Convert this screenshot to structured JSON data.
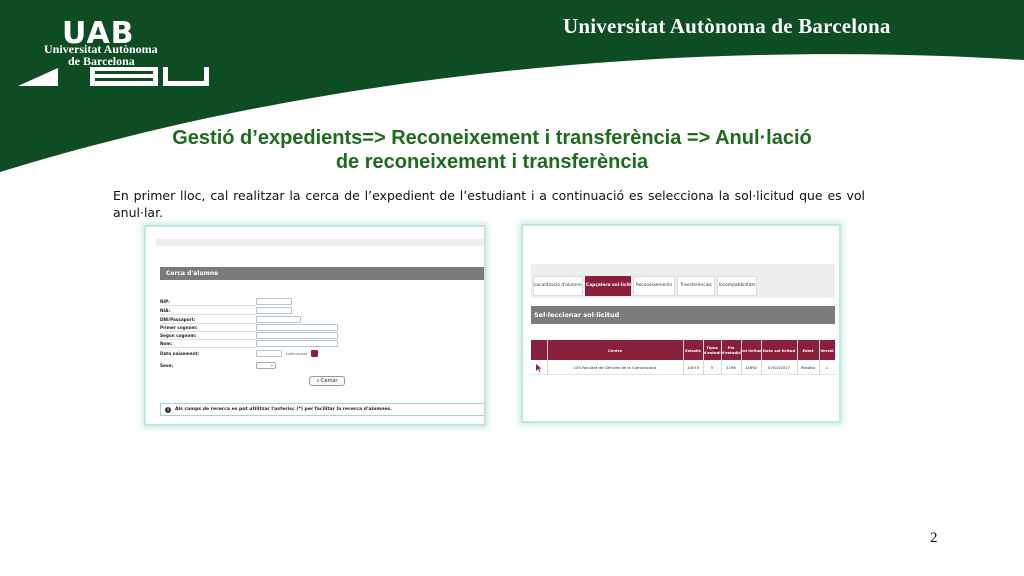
{
  "header": {
    "logo_text": "UAB",
    "logo_line1": "Universitat Autònoma",
    "logo_line2": "de Barcelona",
    "university_name": "Universitat Autònoma de Barcelona",
    "brand_green": "#0e4d24"
  },
  "slide": {
    "title_line1": "Gestió d’expedients=> Reconeixement i transferència => Anul·lació",
    "title_line2": "de reconeixement i transferència",
    "intro_text": "En primer lloc, cal realitzar la cerca de l’expedient de l’estudiant i a continuació es selecciona la sol·licitud que es vol anul·lar.",
    "page_number": "2"
  },
  "search_form": {
    "header": "Cerca d'alumne",
    "fields": [
      {
        "label": "NIP:"
      },
      {
        "label": "NIA:"
      },
      {
        "label": "DNI/Passaport:"
      },
      {
        "label": "Primer cognom:"
      },
      {
        "label": "Segon cognom:"
      },
      {
        "label": "Nom:"
      },
      {
        "label": "Data naixement:"
      },
      {
        "label": "Sexe:"
      }
    ],
    "date_hint": "(dd/mm/aa)",
    "search_button": "Cercar",
    "info_note": "Als camps de recerca es pot utilitzar l'asterisc (*) per facilitar la recerca d'alumnes."
  },
  "request_panel": {
    "tabs": [
      {
        "label": "Localització d'alumne"
      },
      {
        "label": "Capçalera sol·licitud"
      },
      {
        "label": "Reconeixements"
      },
      {
        "label": "Transferències"
      },
      {
        "label": "Incompatibilitats"
      }
    ],
    "section_title": "Sel·leccionar sol·licitud",
    "columns": [
      "Centre",
      "Estudis",
      "Tipus d'estudi",
      "Pla d'estudis",
      "Sol·licitud",
      "Data sol·licitud",
      "Estat",
      "Versió"
    ],
    "row": [
      "105-Facultat de Ciències de la Comunicació",
      "10073",
      "5",
      "1196",
      "14692",
      "07/02/2017",
      "Resolta",
      "1"
    ]
  }
}
